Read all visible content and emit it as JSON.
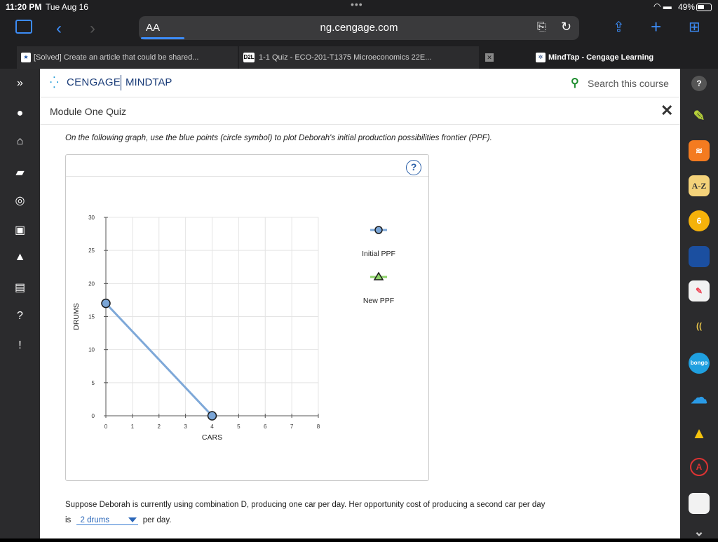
{
  "status": {
    "time": "11:20 PM",
    "date": "Tue Aug 16",
    "battery": "49%"
  },
  "browser": {
    "aa_label": "AA",
    "url": "ng.cengage.com"
  },
  "tabs": [
    {
      "label": "[Solved] Create an article that could be shared...",
      "icon": "star-icon"
    },
    {
      "label": "1-1 Quiz - ECO-201-T1375 Microeconomics 22E...",
      "icon": "d2l-icon",
      "icon_text": "D2L"
    },
    {
      "label": "MindTap - Cengage Learning",
      "icon": "mindtap-icon"
    }
  ],
  "header": {
    "brand": "CENGAGE",
    "product": "MINDTAP",
    "search_placeholder": "Search this course"
  },
  "module": {
    "title": "Module One Quiz"
  },
  "question": {
    "instruction": "On the following graph, use the blue points (circle symbol) to plot Deborah's initial production possibilities frontier (PPF).",
    "suppose_text": "Suppose Deborah is currently using combination D, producing one car per day. Her opportunity cost of producing a second car per day",
    "is_text": "is",
    "answer_value": "2 drums",
    "per_day_text": "per day."
  },
  "chart_data": {
    "type": "line",
    "xlabel": "CARS",
    "ylabel": "DRUMS",
    "xlim": [
      0,
      8
    ],
    "ylim": [
      0,
      30
    ],
    "xticks": [
      0,
      1,
      2,
      3,
      4,
      5,
      6,
      7,
      8
    ],
    "yticks": [
      0,
      5,
      10,
      15,
      20,
      25,
      30
    ],
    "grid": true,
    "legend": [
      {
        "name": "Initial PPF",
        "symbol": "circle",
        "color": "#7ea8d8"
      },
      {
        "name": "New PPF",
        "symbol": "triangle",
        "color": "#8ed36a"
      }
    ],
    "series": [
      {
        "name": "Initial PPF",
        "points": [
          [
            0,
            17
          ],
          [
            4,
            0
          ]
        ]
      }
    ]
  },
  "colors": {
    "ppf_line": "#7ea8d8",
    "point_fill": "#7aa5d6",
    "new_ppf": "#8ed36a",
    "grid": "#e4e4e4"
  }
}
